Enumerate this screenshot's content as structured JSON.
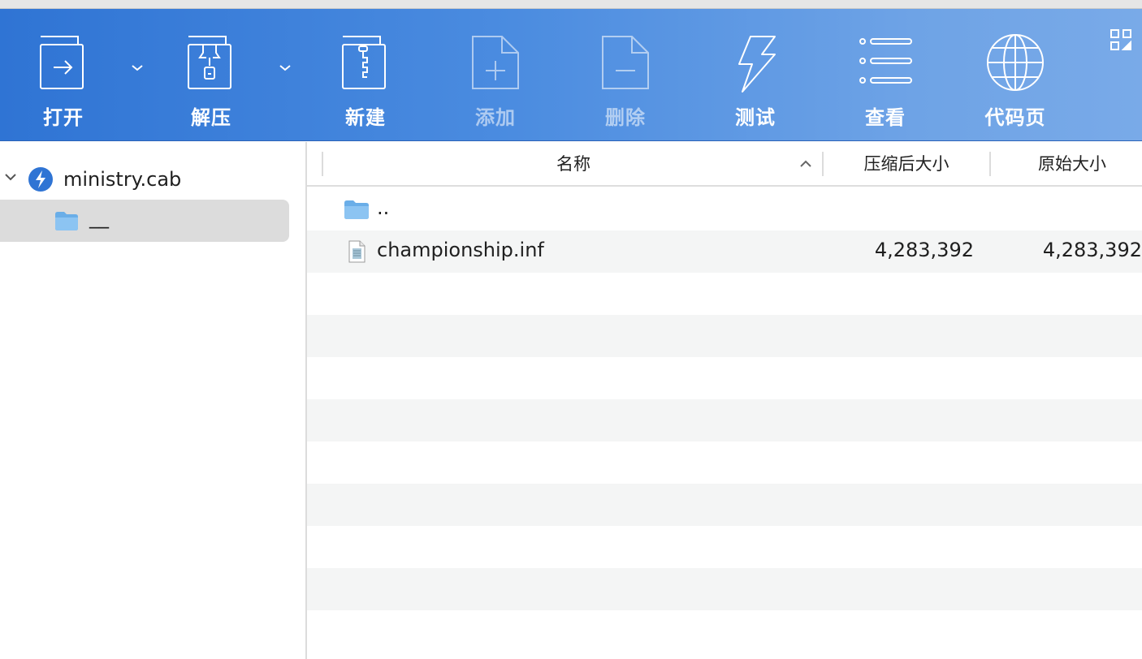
{
  "toolbar": {
    "items": [
      {
        "label": "打开",
        "icon": "open-icon",
        "enabled": true
      },
      {
        "label": "解压",
        "icon": "extract-icon",
        "enabled": true
      },
      {
        "label": "新建",
        "icon": "new-archive-icon",
        "enabled": true
      },
      {
        "label": "添加",
        "icon": "add-file-icon",
        "enabled": false
      },
      {
        "label": "删除",
        "icon": "delete-file-icon",
        "enabled": false
      },
      {
        "label": "测试",
        "icon": "test-lightning-icon",
        "enabled": true
      },
      {
        "label": "查看",
        "icon": "view-list-icon",
        "enabled": true
      },
      {
        "label": "代码页",
        "icon": "globe-icon",
        "enabled": true
      }
    ]
  },
  "sidebar": {
    "root": {
      "name": "ministry.cab",
      "icon": "archive-app-icon"
    },
    "children": [
      {
        "name": "__",
        "icon": "folder-icon",
        "selected": true
      }
    ]
  },
  "table": {
    "columns": {
      "name": "名称",
      "packed": "压缩后大小",
      "original": "原始大小"
    },
    "rows": [
      {
        "name": "..",
        "packed": "",
        "original": "",
        "icon": "folder-icon"
      },
      {
        "name": "championship.inf",
        "packed": "4,283,392",
        "original": "4,283,392",
        "icon": "document-icon"
      }
    ]
  },
  "colors": {
    "toolbar_start": "#2f74d4",
    "toolbar_end": "#79aae8",
    "selection": "#dcdcdc",
    "stripe": "#f4f5f5"
  }
}
